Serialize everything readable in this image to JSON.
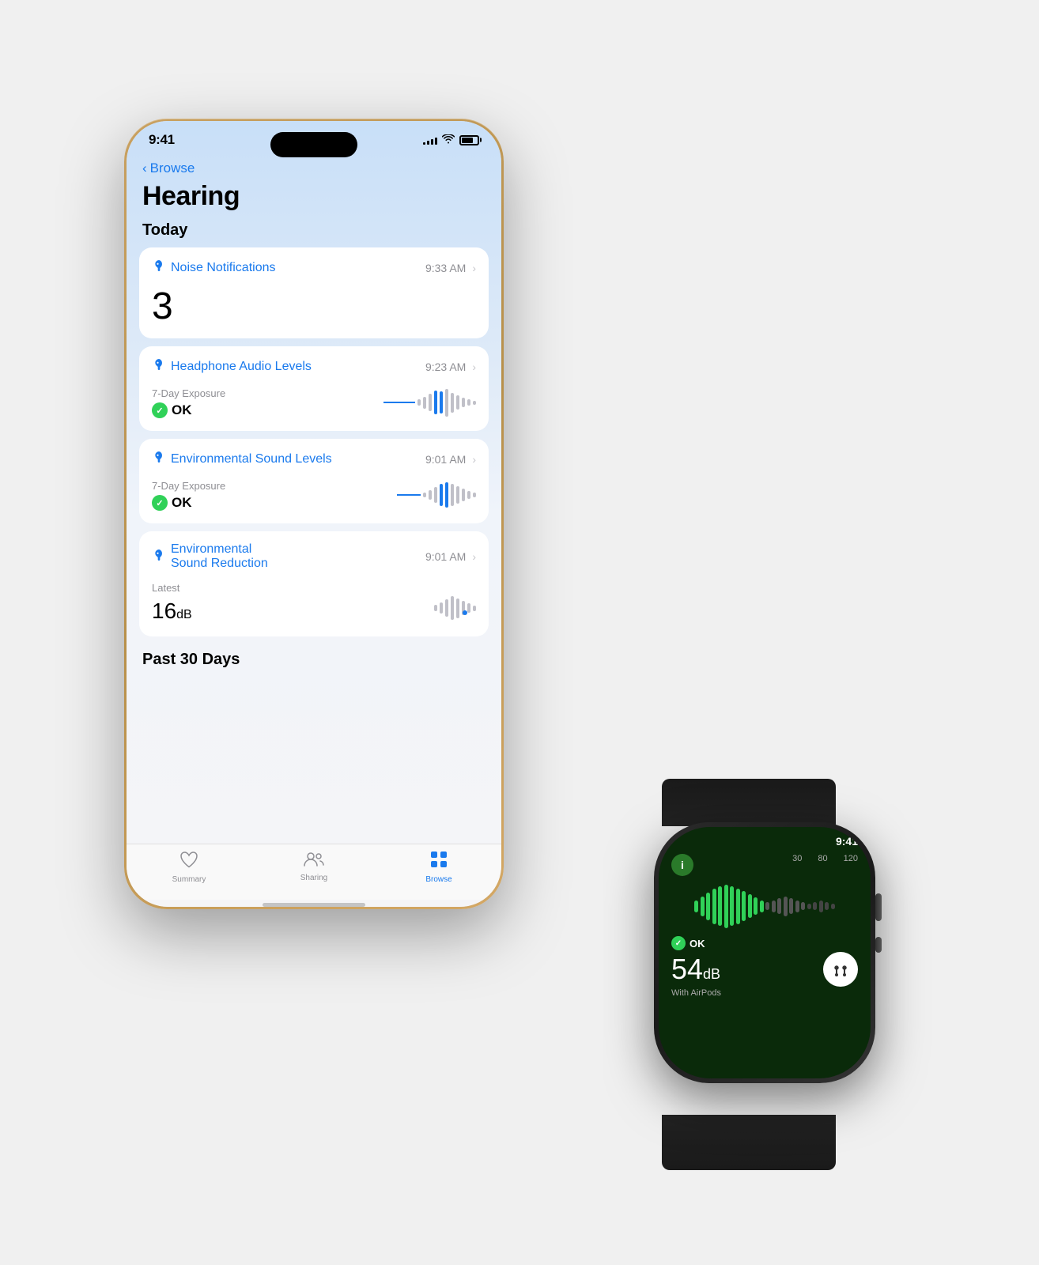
{
  "scene": {
    "background": "#f0f0f0"
  },
  "iphone": {
    "status_bar": {
      "time": "9:41",
      "signal": [
        3,
        5,
        7,
        9,
        11
      ],
      "battery_percent": 75
    },
    "back_nav": {
      "chevron": "‹",
      "label": "Browse"
    },
    "page_title": "Hearing",
    "today_section": "Today",
    "cards": [
      {
        "id": "noise-notifications",
        "title": "Noise Notifications",
        "time": "9:33 AM",
        "body_type": "number",
        "number": "3"
      },
      {
        "id": "headphone-audio",
        "title": "Headphone Audio Levels",
        "time": "9:23 AM",
        "body_type": "exposure",
        "exposure_label": "7-Day Exposure",
        "status": "OK"
      },
      {
        "id": "environmental-sound",
        "title": "Environmental Sound Levels",
        "time": "9:01 AM",
        "body_type": "exposure",
        "exposure_label": "7-Day Exposure",
        "status": "OK"
      },
      {
        "id": "environmental-reduction",
        "title": "Environmental\nSound Reduction",
        "time": "9:01 AM",
        "body_type": "db",
        "latest_label": "Latest",
        "db_value": "16",
        "db_unit": "dB"
      }
    ],
    "past_section": "Past 30 Days",
    "tab_bar": {
      "tabs": [
        {
          "id": "summary",
          "label": "Summary",
          "icon": "♡",
          "active": false
        },
        {
          "id": "sharing",
          "label": "Sharing",
          "icon": "👥",
          "active": false
        },
        {
          "id": "browse",
          "label": "Browse",
          "icon": "⊞",
          "active": true
        }
      ]
    }
  },
  "watch": {
    "time": "9:41",
    "db_value": "54",
    "db_unit": "dB",
    "status": "OK",
    "with_label": "With AirPods",
    "scale_labels": [
      "30",
      "80",
      "120"
    ],
    "info_icon": "i"
  }
}
